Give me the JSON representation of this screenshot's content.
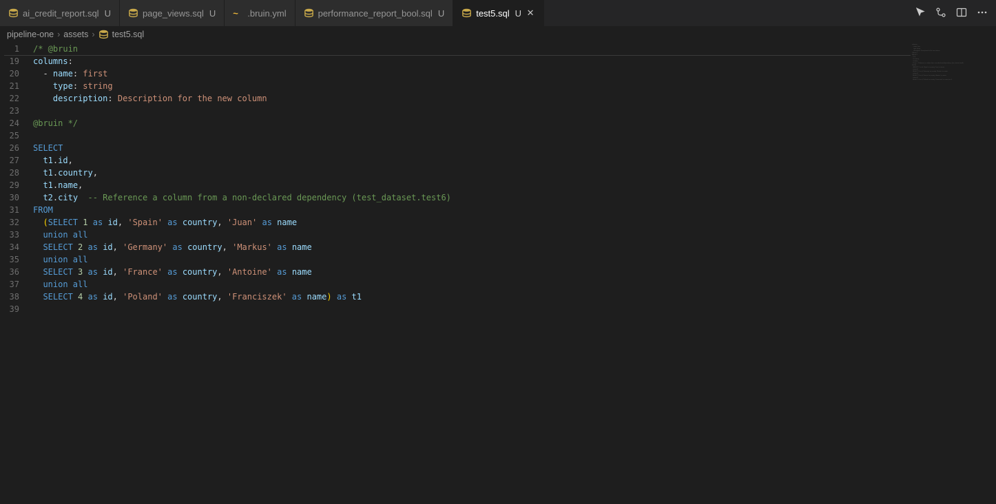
{
  "tabs": [
    {
      "name": "ai_credit_report.sql",
      "unsaved": "U",
      "type": "sql"
    },
    {
      "name": "page_views.sql",
      "unsaved": "U",
      "type": "sql"
    },
    {
      "name": ".bruin.yml",
      "unsaved": "",
      "type": "yml"
    },
    {
      "name": "performance_report_bool.sql",
      "unsaved": "U",
      "type": "sql"
    },
    {
      "name": "test5.sql",
      "unsaved": "U",
      "type": "sql",
      "active": true,
      "closable": true
    }
  ],
  "breadcrumbs": {
    "seg1": "pipeline-one",
    "seg2": "assets",
    "seg3": "test5.sql"
  },
  "sticky": {
    "lineNumber": "1",
    "text": "/* @bruin"
  },
  "lines": [
    {
      "n": "19",
      "tokens": [
        {
          "c": "tok-key",
          "t": "columns"
        },
        {
          "c": "tok-colon",
          "t": ":"
        }
      ]
    },
    {
      "n": "20",
      "tokens": [
        {
          "c": "tok-plain",
          "t": "  - "
        },
        {
          "c": "tok-key",
          "t": "name"
        },
        {
          "c": "tok-colon",
          "t": ": "
        },
        {
          "c": "tok-val",
          "t": "first"
        }
      ]
    },
    {
      "n": "21",
      "tokens": [
        {
          "c": "tok-plain",
          "t": "    "
        },
        {
          "c": "tok-key",
          "t": "type"
        },
        {
          "c": "tok-colon",
          "t": ": "
        },
        {
          "c": "tok-val",
          "t": "string"
        }
      ]
    },
    {
      "n": "22",
      "tokens": [
        {
          "c": "tok-plain",
          "t": "    "
        },
        {
          "c": "tok-key",
          "t": "description"
        },
        {
          "c": "tok-colon",
          "t": ": "
        },
        {
          "c": "tok-val",
          "t": "Description for the new column"
        }
      ]
    },
    {
      "n": "23",
      "tokens": []
    },
    {
      "n": "24",
      "tokens": [
        {
          "c": "tok-comment",
          "t": "@bruin */"
        }
      ]
    },
    {
      "n": "25",
      "tokens": []
    },
    {
      "n": "26",
      "tokens": [
        {
          "c": "tok-kw",
          "t": "SELECT"
        }
      ]
    },
    {
      "n": "27",
      "tokens": [
        {
          "c": "tok-plain",
          "t": "  "
        },
        {
          "c": "tok-id",
          "t": "t1"
        },
        {
          "c": "tok-op",
          "t": "."
        },
        {
          "c": "tok-id",
          "t": "id"
        },
        {
          "c": "tok-op",
          "t": ","
        }
      ]
    },
    {
      "n": "28",
      "tokens": [
        {
          "c": "tok-plain",
          "t": "  "
        },
        {
          "c": "tok-id",
          "t": "t1"
        },
        {
          "c": "tok-op",
          "t": "."
        },
        {
          "c": "tok-id",
          "t": "country"
        },
        {
          "c": "tok-op",
          "t": ","
        }
      ]
    },
    {
      "n": "29",
      "tokens": [
        {
          "c": "tok-plain",
          "t": "  "
        },
        {
          "c": "tok-id",
          "t": "t1"
        },
        {
          "c": "tok-op",
          "t": "."
        },
        {
          "c": "tok-id",
          "t": "name"
        },
        {
          "c": "tok-op",
          "t": ","
        }
      ]
    },
    {
      "n": "30",
      "tokens": [
        {
          "c": "tok-plain",
          "t": "  "
        },
        {
          "c": "tok-id",
          "t": "t2"
        },
        {
          "c": "tok-op",
          "t": "."
        },
        {
          "c": "tok-id",
          "t": "city"
        },
        {
          "c": "tok-plain",
          "t": "  "
        },
        {
          "c": "tok-comment",
          "t": "-- Reference a column from a non-declared dependency (test_dataset.test6)"
        }
      ]
    },
    {
      "n": "31",
      "tokens": [
        {
          "c": "tok-kw",
          "t": "FROM"
        }
      ]
    },
    {
      "n": "32",
      "tokens": [
        {
          "c": "tok-plain",
          "t": "  "
        },
        {
          "c": "tok-paren",
          "t": "("
        },
        {
          "c": "tok-kw",
          "t": "SELECT"
        },
        {
          "c": "tok-plain",
          "t": " "
        },
        {
          "c": "tok-num",
          "t": "1"
        },
        {
          "c": "tok-plain",
          "t": " "
        },
        {
          "c": "tok-kw",
          "t": "as"
        },
        {
          "c": "tok-plain",
          "t": " "
        },
        {
          "c": "tok-id",
          "t": "id"
        },
        {
          "c": "tok-op",
          "t": ", "
        },
        {
          "c": "tok-str",
          "t": "'Spain'"
        },
        {
          "c": "tok-plain",
          "t": " "
        },
        {
          "c": "tok-kw",
          "t": "as"
        },
        {
          "c": "tok-plain",
          "t": " "
        },
        {
          "c": "tok-id",
          "t": "country"
        },
        {
          "c": "tok-op",
          "t": ", "
        },
        {
          "c": "tok-str",
          "t": "'Juan'"
        },
        {
          "c": "tok-plain",
          "t": " "
        },
        {
          "c": "tok-kw",
          "t": "as"
        },
        {
          "c": "tok-plain",
          "t": " "
        },
        {
          "c": "tok-id",
          "t": "name"
        }
      ]
    },
    {
      "n": "33",
      "tokens": [
        {
          "c": "tok-plain",
          "t": "  "
        },
        {
          "c": "tok-kw",
          "t": "union all"
        }
      ]
    },
    {
      "n": "34",
      "tokens": [
        {
          "c": "tok-plain",
          "t": "  "
        },
        {
          "c": "tok-kw",
          "t": "SELECT"
        },
        {
          "c": "tok-plain",
          "t": " "
        },
        {
          "c": "tok-num",
          "t": "2"
        },
        {
          "c": "tok-plain",
          "t": " "
        },
        {
          "c": "tok-kw",
          "t": "as"
        },
        {
          "c": "tok-plain",
          "t": " "
        },
        {
          "c": "tok-id",
          "t": "id"
        },
        {
          "c": "tok-op",
          "t": ", "
        },
        {
          "c": "tok-str",
          "t": "'Germany'"
        },
        {
          "c": "tok-plain",
          "t": " "
        },
        {
          "c": "tok-kw",
          "t": "as"
        },
        {
          "c": "tok-plain",
          "t": " "
        },
        {
          "c": "tok-id",
          "t": "country"
        },
        {
          "c": "tok-op",
          "t": ", "
        },
        {
          "c": "tok-str",
          "t": "'Markus'"
        },
        {
          "c": "tok-plain",
          "t": " "
        },
        {
          "c": "tok-kw",
          "t": "as"
        },
        {
          "c": "tok-plain",
          "t": " "
        },
        {
          "c": "tok-id",
          "t": "name"
        }
      ]
    },
    {
      "n": "35",
      "tokens": [
        {
          "c": "tok-plain",
          "t": "  "
        },
        {
          "c": "tok-kw",
          "t": "union all"
        }
      ]
    },
    {
      "n": "36",
      "tokens": [
        {
          "c": "tok-plain",
          "t": "  "
        },
        {
          "c": "tok-kw",
          "t": "SELECT"
        },
        {
          "c": "tok-plain",
          "t": " "
        },
        {
          "c": "tok-num",
          "t": "3"
        },
        {
          "c": "tok-plain",
          "t": " "
        },
        {
          "c": "tok-kw",
          "t": "as"
        },
        {
          "c": "tok-plain",
          "t": " "
        },
        {
          "c": "tok-id",
          "t": "id"
        },
        {
          "c": "tok-op",
          "t": ", "
        },
        {
          "c": "tok-str",
          "t": "'France'"
        },
        {
          "c": "tok-plain",
          "t": " "
        },
        {
          "c": "tok-kw",
          "t": "as"
        },
        {
          "c": "tok-plain",
          "t": " "
        },
        {
          "c": "tok-id",
          "t": "country"
        },
        {
          "c": "tok-op",
          "t": ", "
        },
        {
          "c": "tok-str",
          "t": "'Antoine'"
        },
        {
          "c": "tok-plain",
          "t": " "
        },
        {
          "c": "tok-kw",
          "t": "as"
        },
        {
          "c": "tok-plain",
          "t": " "
        },
        {
          "c": "tok-id",
          "t": "name"
        }
      ]
    },
    {
      "n": "37",
      "tokens": [
        {
          "c": "tok-plain",
          "t": "  "
        },
        {
          "c": "tok-kw",
          "t": "union all"
        }
      ]
    },
    {
      "n": "38",
      "tokens": [
        {
          "c": "tok-plain",
          "t": "  "
        },
        {
          "c": "tok-kw",
          "t": "SELECT"
        },
        {
          "c": "tok-plain",
          "t": " "
        },
        {
          "c": "tok-num",
          "t": "4"
        },
        {
          "c": "tok-plain",
          "t": " "
        },
        {
          "c": "tok-kw",
          "t": "as"
        },
        {
          "c": "tok-plain",
          "t": " "
        },
        {
          "c": "tok-id",
          "t": "id"
        },
        {
          "c": "tok-op",
          "t": ", "
        },
        {
          "c": "tok-str",
          "t": "'Poland'"
        },
        {
          "c": "tok-plain",
          "t": " "
        },
        {
          "c": "tok-kw",
          "t": "as"
        },
        {
          "c": "tok-plain",
          "t": " "
        },
        {
          "c": "tok-id",
          "t": "country"
        },
        {
          "c": "tok-op",
          "t": ", "
        },
        {
          "c": "tok-str",
          "t": "'Franciszek'"
        },
        {
          "c": "tok-plain",
          "t": " "
        },
        {
          "c": "tok-kw",
          "t": "as"
        },
        {
          "c": "tok-plain",
          "t": " "
        },
        {
          "c": "tok-id",
          "t": "name"
        },
        {
          "c": "tok-paren",
          "t": ")"
        },
        {
          "c": "tok-plain",
          "t": " "
        },
        {
          "c": "tok-kw",
          "t": "as"
        },
        {
          "c": "tok-plain",
          "t": " "
        },
        {
          "c": "tok-id",
          "t": "t1"
        }
      ]
    },
    {
      "n": "39",
      "tokens": []
    }
  ]
}
